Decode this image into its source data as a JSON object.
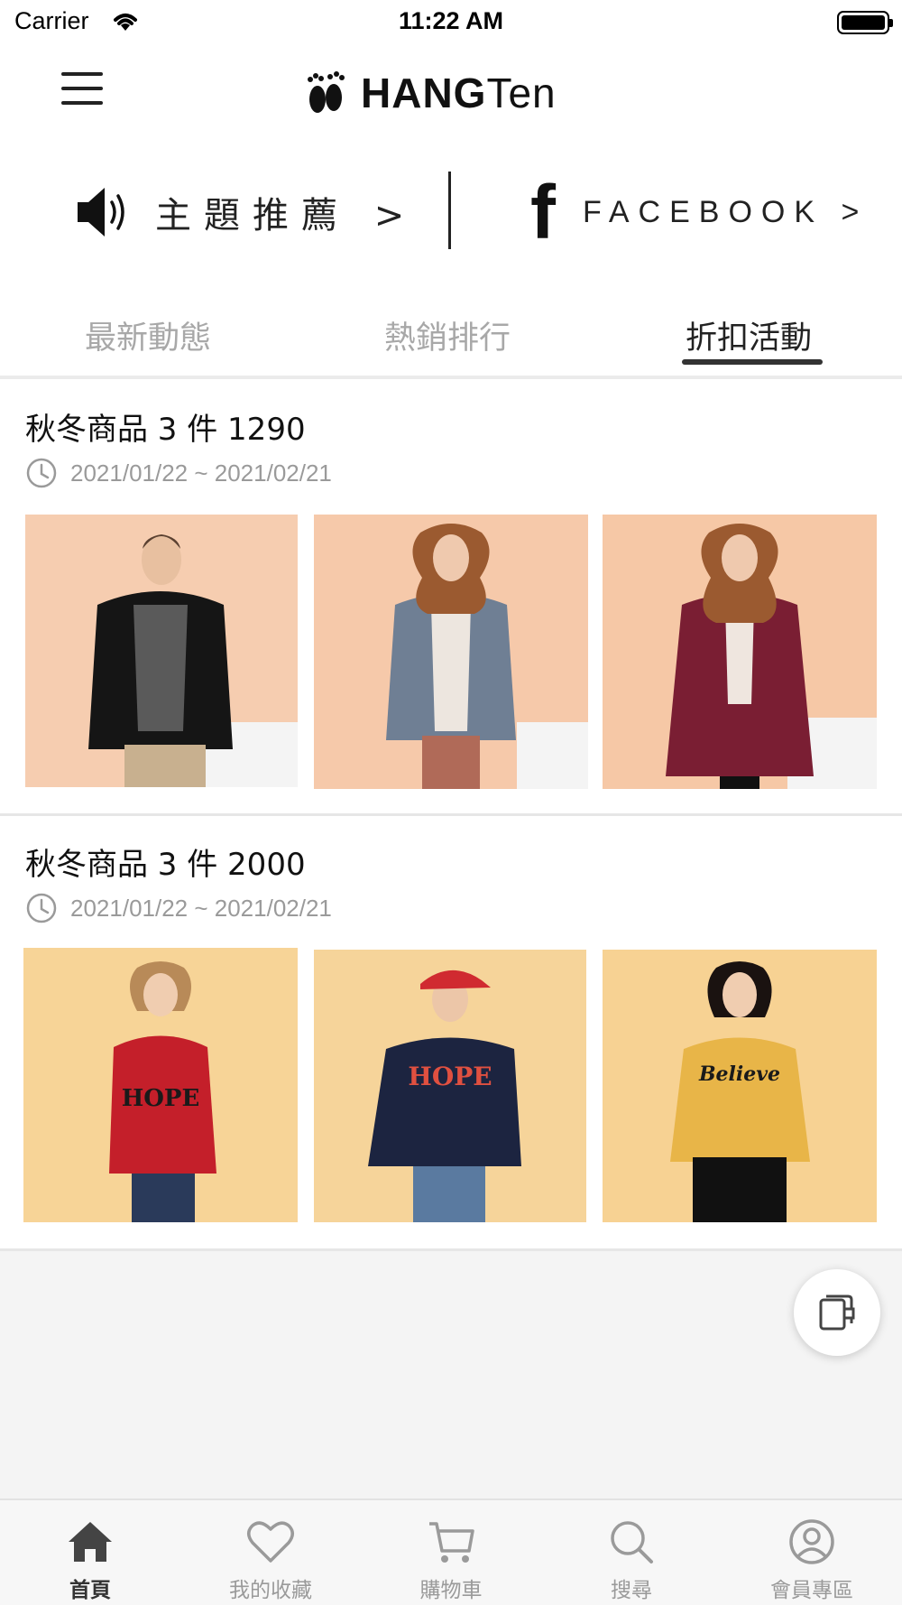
{
  "status_bar": {
    "carrier": "Carrier",
    "time": "11:22 AM"
  },
  "header": {
    "logo_text_bold": "HANG",
    "logo_text_light": "Ten",
    "menu_icon": "hamburger-menu-icon"
  },
  "promo": {
    "theme_label": "主題推薦 >",
    "facebook_label": "FACEBOOK >"
  },
  "tabs": [
    {
      "label": "最新動態",
      "active": false
    },
    {
      "label": "熱銷排行",
      "active": false
    },
    {
      "label": "折扣活動",
      "active": true
    }
  ],
  "sections": [
    {
      "title": "秋冬商品 3 件 1290",
      "date_range": "2021/01/22 ~ 2021/02/21",
      "products": [
        {
          "desc": "man-black-puffer-jacket",
          "bg": "#f6cdb0"
        },
        {
          "desc": "woman-gray-jacket",
          "bg": "#f6c9aa"
        },
        {
          "desc": "woman-burgundy-long-puffer",
          "bg": "#f6c8a6"
        }
      ]
    },
    {
      "title": "秋冬商品 3 件 2000",
      "date_range": "2021/01/22 ~ 2021/02/21",
      "products": [
        {
          "desc": "girl-red-hoodie",
          "bg": "#f7d497"
        },
        {
          "desc": "man-navy-hoodie-red-cap",
          "bg": "#f6d49a"
        },
        {
          "desc": "woman-yellow-hoodie",
          "bg": "#f7d293"
        }
      ]
    }
  ],
  "bottom_nav": [
    {
      "label": "首頁",
      "icon": "home-icon",
      "active": true
    },
    {
      "label": "我的收藏",
      "icon": "heart-icon",
      "active": false
    },
    {
      "label": "購物車",
      "icon": "cart-icon",
      "active": false
    },
    {
      "label": "搜尋",
      "icon": "search-icon",
      "active": false
    },
    {
      "label": "會員專區",
      "icon": "user-icon",
      "active": false
    }
  ],
  "colors": {
    "accent": "#333333",
    "inactive_text": "#a8a8a8",
    "gray_bg": "#f4f4f4"
  }
}
